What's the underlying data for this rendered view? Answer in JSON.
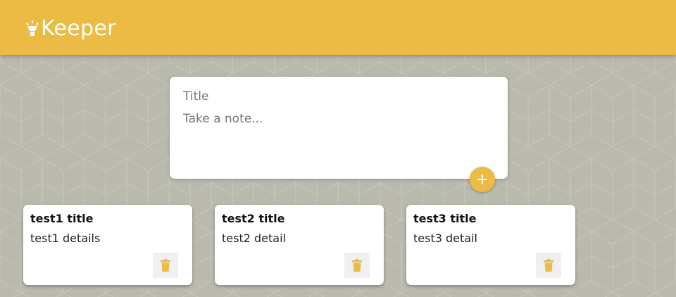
{
  "app": {
    "name": "Keeper"
  },
  "colors": {
    "header": "#ecbb43",
    "background": "#b9b9ad",
    "accent": "#ecbb43",
    "card": "#ffffff",
    "delete_bg": "#f0f0f0"
  },
  "create_note": {
    "title_placeholder": "Title",
    "content_placeholder": "Take a note...",
    "add_icon": "plus-icon"
  },
  "notes": [
    {
      "title": "test1 title",
      "content": "test1 details",
      "delete_icon": "trash-icon"
    },
    {
      "title": "test2 title",
      "content": "test2 detail",
      "delete_icon": "trash-icon"
    },
    {
      "title": "test3 title",
      "content": "test3 detail",
      "delete_icon": "trash-icon"
    }
  ]
}
